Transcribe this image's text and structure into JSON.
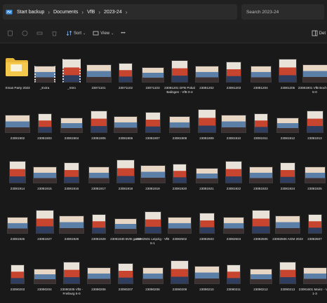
{
  "address_bar": {
    "crumbs": [
      "Start backup",
      "Documents",
      "VfB",
      "2023-24"
    ],
    "separator": "›"
  },
  "search": {
    "placeholder": "Search 2023-24"
  },
  "command_bar": {
    "sort_label": "Sort",
    "view_label": "View",
    "more_label": "•••",
    "details_label": "Det"
  },
  "items": [
    {
      "label": "Xmas Party 2023",
      "kind": "folder"
    },
    {
      "label": "_Extra",
      "kind": "folder-photo"
    },
    {
      "label": "_Intro",
      "kind": "folder-photo"
    },
    {
      "label": "23071101",
      "kind": "photo"
    },
    {
      "label": "23071102",
      "kind": "photo"
    },
    {
      "label": "23071103",
      "kind": "photo"
    },
    {
      "label": "23081201 DFB Pokal Balingen - VfB 0-4",
      "kind": "photo"
    },
    {
      "label": "23081202",
      "kind": "photo"
    },
    {
      "label": "23081203",
      "kind": "photo"
    },
    {
      "label": "23081204",
      "kind": "photo"
    },
    {
      "label": "23081205",
      "kind": "photo"
    },
    {
      "label": "23081901 VfB Bochum 5-0",
      "kind": "photo"
    },
    {
      "label": "23081902",
      "kind": "photo"
    },
    {
      "label": "23081903",
      "kind": "photo"
    },
    {
      "label": "23081904",
      "kind": "photo"
    },
    {
      "label": "23081905",
      "kind": "photo"
    },
    {
      "label": "23081906",
      "kind": "photo"
    },
    {
      "label": "23081907",
      "kind": "photo"
    },
    {
      "label": "23081908",
      "kind": "photo"
    },
    {
      "label": "23081909",
      "kind": "photo"
    },
    {
      "label": "23081910",
      "kind": "photo"
    },
    {
      "label": "23081911",
      "kind": "photo"
    },
    {
      "label": "23081912",
      "kind": "photo"
    },
    {
      "label": "23081913",
      "kind": "photo"
    },
    {
      "label": "23081914",
      "kind": "photo"
    },
    {
      "label": "23081915",
      "kind": "photo"
    },
    {
      "label": "23081916",
      "kind": "photo"
    },
    {
      "label": "23081917",
      "kind": "photo"
    },
    {
      "label": "23081918",
      "kind": "photo"
    },
    {
      "label": "23081919",
      "kind": "photo"
    },
    {
      "label": "23081920",
      "kind": "photo"
    },
    {
      "label": "23081921",
      "kind": "photo"
    },
    {
      "label": "23081922",
      "kind": "photo"
    },
    {
      "label": "23081923",
      "kind": "photo"
    },
    {
      "label": "23081924",
      "kind": "photo"
    },
    {
      "label": "23081925",
      "kind": "photo"
    },
    {
      "label": "23081926",
      "kind": "photo"
    },
    {
      "label": "23081927",
      "kind": "photo"
    },
    {
      "label": "23081928",
      "kind": "photo"
    },
    {
      "label": "23081929",
      "kind": "photo"
    },
    {
      "label": "23081930 BVB game",
      "kind": "photo"
    },
    {
      "label": "23082501 Leipzig - VfB 5-1",
      "kind": "photo"
    },
    {
      "label": "23082502",
      "kind": "photo"
    },
    {
      "label": "23082503",
      "kind": "photo"
    },
    {
      "label": "23082504",
      "kind": "photo"
    },
    {
      "label": "23082505",
      "kind": "photo"
    },
    {
      "label": "23082506 AGM 2023",
      "kind": "photo"
    },
    {
      "label": "23082507",
      "kind": "photo"
    },
    {
      "label": "23090203",
      "kind": "photo"
    },
    {
      "label": "23090204",
      "kind": "photo"
    },
    {
      "label": "23090205 VfB - Freiburg 5-0",
      "kind": "photo"
    },
    {
      "label": "23090206",
      "kind": "photo"
    },
    {
      "label": "23090207",
      "kind": "photo"
    },
    {
      "label": "23090208",
      "kind": "photo"
    },
    {
      "label": "23090209",
      "kind": "photo"
    },
    {
      "label": "23090210",
      "kind": "photo"
    },
    {
      "label": "23090211",
      "kind": "photo"
    },
    {
      "label": "23090212",
      "kind": "photo"
    },
    {
      "label": "23090213",
      "kind": "photo"
    },
    {
      "label": "23091601 Mainz - VfB 1-3",
      "kind": "photo"
    }
  ]
}
